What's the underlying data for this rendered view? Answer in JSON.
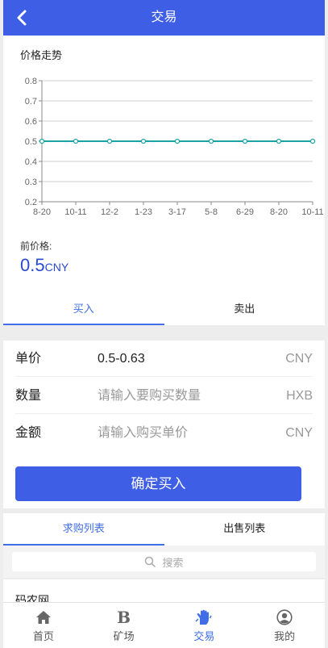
{
  "header": {
    "title": "交易"
  },
  "chart_section": {
    "title": "价格走势"
  },
  "chart_data": {
    "type": "line",
    "x": [
      "8-20",
      "10-11",
      "12-2",
      "1-23",
      "3-17",
      "5-8",
      "6-29",
      "8-20",
      "10-11"
    ],
    "series": [
      {
        "values": [
          0.5,
          0.5,
          0.5,
          0.5,
          0.5,
          0.5,
          0.5,
          0.5,
          0.5
        ]
      }
    ],
    "yticks": [
      "0.2",
      "0.3",
      "0.4",
      "0.5",
      "0.6",
      "0.7",
      "0.8"
    ],
    "ylim": [
      0.2,
      0.8
    ],
    "grid": true,
    "line_color": "#19a3a3"
  },
  "price": {
    "label": "前价格:",
    "value": "0.5",
    "unit": "CNY"
  },
  "trade_tabs": [
    {
      "label": "买入"
    },
    {
      "label": "卖出"
    }
  ],
  "form": {
    "unit_price": {
      "label": "单价",
      "value": "0.5-0.63",
      "unit": "CNY"
    },
    "quantity": {
      "label": "数量",
      "placeholder": "请输入要购买数量",
      "unit": "HXB"
    },
    "amount": {
      "label": "金额",
      "placeholder": "请输入购买单价",
      "unit": "CNY"
    },
    "submit_label": "确定买入"
  },
  "list_tabs": [
    {
      "label": "求购列表"
    },
    {
      "label": "出售列表"
    }
  ],
  "search": {
    "placeholder": "搜索"
  },
  "list_items": [
    {
      "name": "码农网"
    }
  ],
  "bottom_nav": [
    {
      "label": "首页",
      "icon": "home-icon"
    },
    {
      "label": "矿场",
      "icon": "mine-b-icon"
    },
    {
      "label": "交易",
      "icon": "trade-hand-icon"
    },
    {
      "label": "我的",
      "icon": "user-icon"
    }
  ],
  "colors": {
    "primary": "#3f5ee6",
    "active_tab": "#3f6ee6",
    "price": "#2a4ad4",
    "line": "#19a3a3"
  }
}
